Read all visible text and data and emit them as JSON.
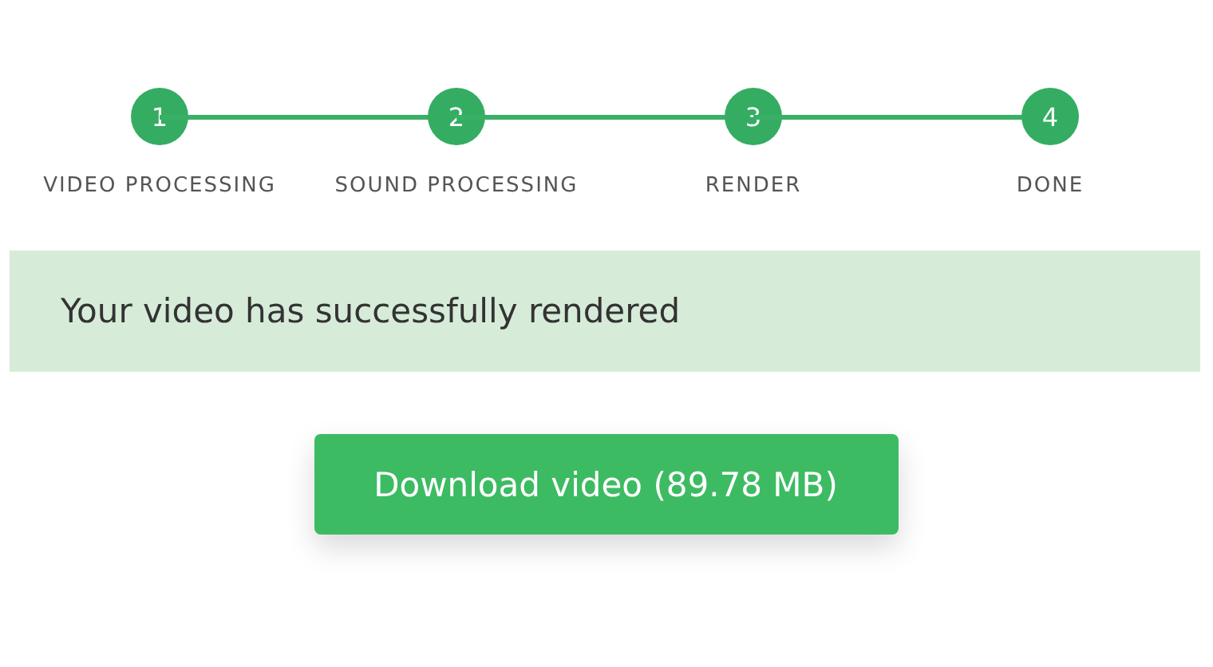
{
  "steps": [
    {
      "number": "1",
      "label": "VIDEO PROCESSING",
      "completed": true
    },
    {
      "number": "2",
      "label": "SOUND PROCESSING",
      "completed": true
    },
    {
      "number": "3",
      "label": "RENDER",
      "completed": true
    },
    {
      "number": "4",
      "label": "DONE",
      "completed": true
    }
  ],
  "alert": {
    "message": "Your video has successfully rendered"
  },
  "download_button": {
    "label": "Download video (89.78 MB)"
  }
}
